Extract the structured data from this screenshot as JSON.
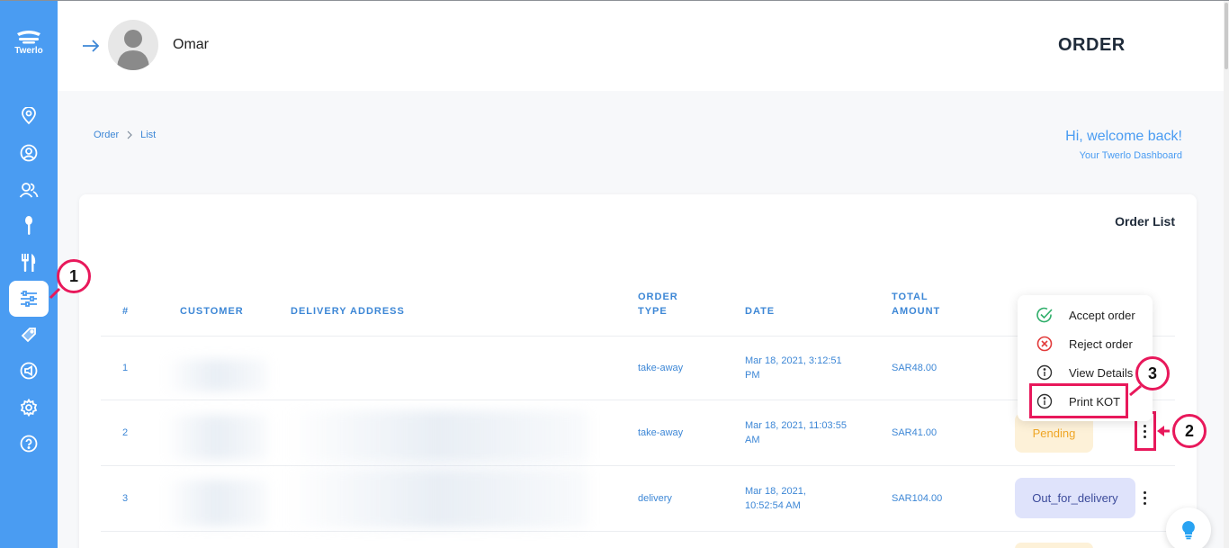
{
  "app": {
    "logo_text": "Twerlo"
  },
  "header": {
    "user_name": "Omar",
    "page_title": "ORDER"
  },
  "breadcrumb": {
    "items": [
      "Order",
      "List"
    ],
    "separator": ">"
  },
  "welcome": {
    "greeting": "Hi, welcome back!",
    "subtitle": "Your Twerlo Dashboard"
  },
  "sidebar": {
    "items": [
      {
        "icon": "location-pin-icon"
      },
      {
        "icon": "user-circle-icon"
      },
      {
        "icon": "users-icon"
      },
      {
        "icon": "spoon-icon"
      },
      {
        "icon": "fork-knife-icon"
      },
      {
        "icon": "sliders-icon",
        "active": true
      },
      {
        "icon": "ticket-icon"
      },
      {
        "icon": "megaphone-icon"
      },
      {
        "icon": "gear-icon"
      },
      {
        "icon": "help-icon"
      }
    ]
  },
  "table": {
    "title": "Order List",
    "headers": {
      "num": "#",
      "customer": "CUSTOMER",
      "address": "DELIVERY ADDRESS",
      "order_type_1": "ORDER",
      "order_type_2": "TYPE",
      "date": "DATE",
      "total_1": "TOTAL",
      "total_2": "AMOUNT"
    },
    "rows": [
      {
        "num": "1",
        "type": "take-away",
        "date_1": "Mar 18, 2021, 3:12:51",
        "date_2": "PM",
        "amount": "SAR48.00",
        "status": ""
      },
      {
        "num": "2",
        "type": "take-away",
        "date_1": "Mar 18, 2021, 11:03:55",
        "date_2": "AM",
        "amount": "SAR41.00",
        "status": "Pending"
      },
      {
        "num": "3",
        "type": "delivery",
        "date_1": "Mar 18, 2021,",
        "date_2": "10:52:54 AM",
        "amount": "SAR104.00",
        "status": "Out_for_delivery"
      }
    ]
  },
  "menu": {
    "items": [
      {
        "label": "Accept order",
        "icon": "check-circle-icon",
        "color": "#2fae6a"
      },
      {
        "label": "Reject order",
        "icon": "x-circle-icon",
        "color": "#e23b3b"
      },
      {
        "label": "View Details",
        "icon": "info-circle-icon",
        "color": "#333333"
      },
      {
        "label": "Print KOT",
        "icon": "info-circle-icon",
        "color": "#333333"
      }
    ]
  },
  "callouts": [
    "1",
    "2",
    "3"
  ],
  "colors": {
    "sidebar": "#4a9cf2",
    "accent": "#3d87d6",
    "highlight": "#e8185b",
    "pending": "#efa626"
  }
}
